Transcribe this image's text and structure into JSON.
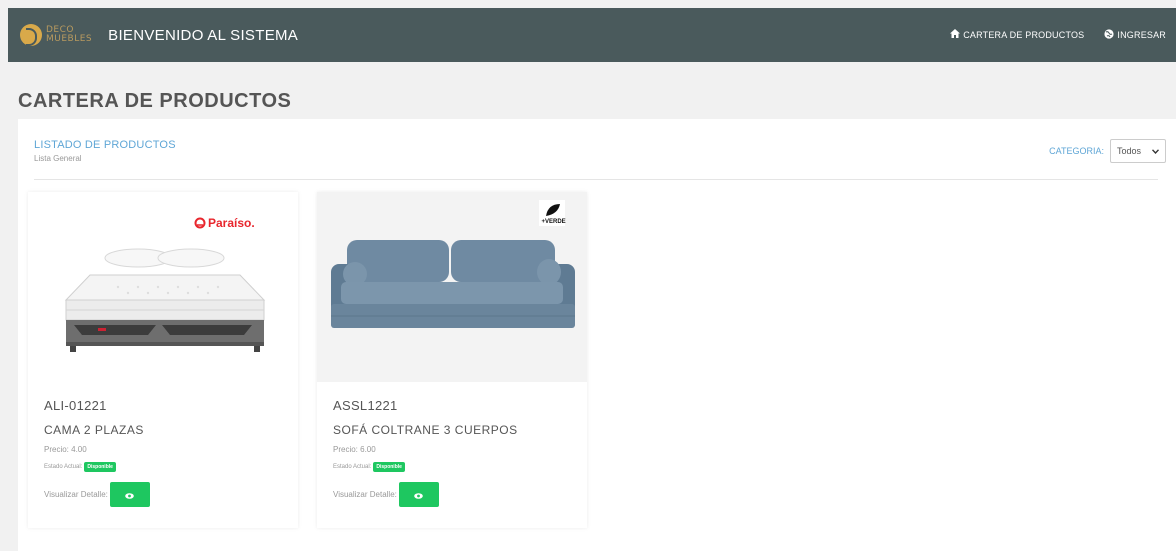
{
  "navbar": {
    "logo_line1": "DECO",
    "logo_line2": "MUEBLES",
    "title": "BIENVENIDO AL SISTEMA",
    "links": [
      {
        "label": "CARTERA DE PRODUCTOS",
        "icon": "home-icon"
      },
      {
        "label": "INGRESAR",
        "icon": "globe-icon"
      }
    ]
  },
  "page": {
    "title": "CARTERA DE PRODUCTOS"
  },
  "panel": {
    "title": "LISTADO DE PRODUCTOS",
    "subtitle": "Lista General",
    "category_label": "CATEGORIA:",
    "category_value": "Todos"
  },
  "products": [
    {
      "code": "ALI-01221",
      "name": "CAMA 2 PLAZAS",
      "price": "Precio: 4.00",
      "status_label": "Estado Actual:",
      "status": "Disponible",
      "detail_label": "Visualizar Detalle:",
      "brand_label": "Paraíso.",
      "image": "bed-image"
    },
    {
      "code": "ASSL1221",
      "name": "SOFÁ COLTRANE 3 CUERPOS",
      "price": "Precio: 6.00",
      "status_label": "Estado Actual:",
      "status": "Disponible",
      "detail_label": "Visualizar Detalle:",
      "brand_label": "+VERDE",
      "image": "sofa-image"
    }
  ],
  "colors": {
    "navbar": "#4a5a5c",
    "accent_blue": "#5fa6d6",
    "success_green": "#1ec760",
    "paraiso_red": "#e8262d"
  }
}
